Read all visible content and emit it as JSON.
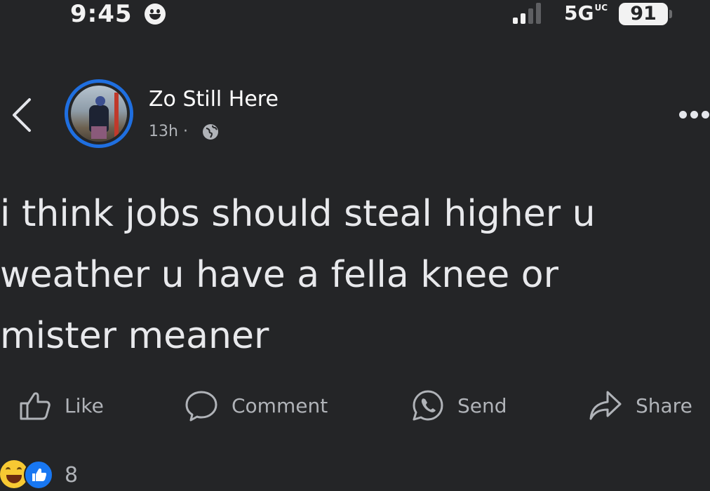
{
  "status_bar": {
    "time": "9:45",
    "network": "5G",
    "network_sup": "UC",
    "battery": "91",
    "signal_bars_active": 2,
    "signal_bars_total": 4
  },
  "post": {
    "author": "Zo Still Here",
    "timestamp": "13h",
    "separator": "·",
    "audience_icon": "globe-icon",
    "text_lines": [
      "i think jobs should steal higher u",
      "weather u have a fella knee or",
      "mister meaner"
    ]
  },
  "actions": {
    "like": "Like",
    "comment": "Comment",
    "send": "Send",
    "share": "Share"
  },
  "reactions": {
    "icons": [
      "haha-reaction-icon",
      "like-reaction-icon"
    ],
    "count": "8"
  },
  "colors": {
    "background": "#242527",
    "avatar_ring": "#1f6fe0",
    "like_reaction": "#1877f2",
    "haha_reaction": "#f7c933",
    "secondary_text": "#b0b3b8"
  }
}
